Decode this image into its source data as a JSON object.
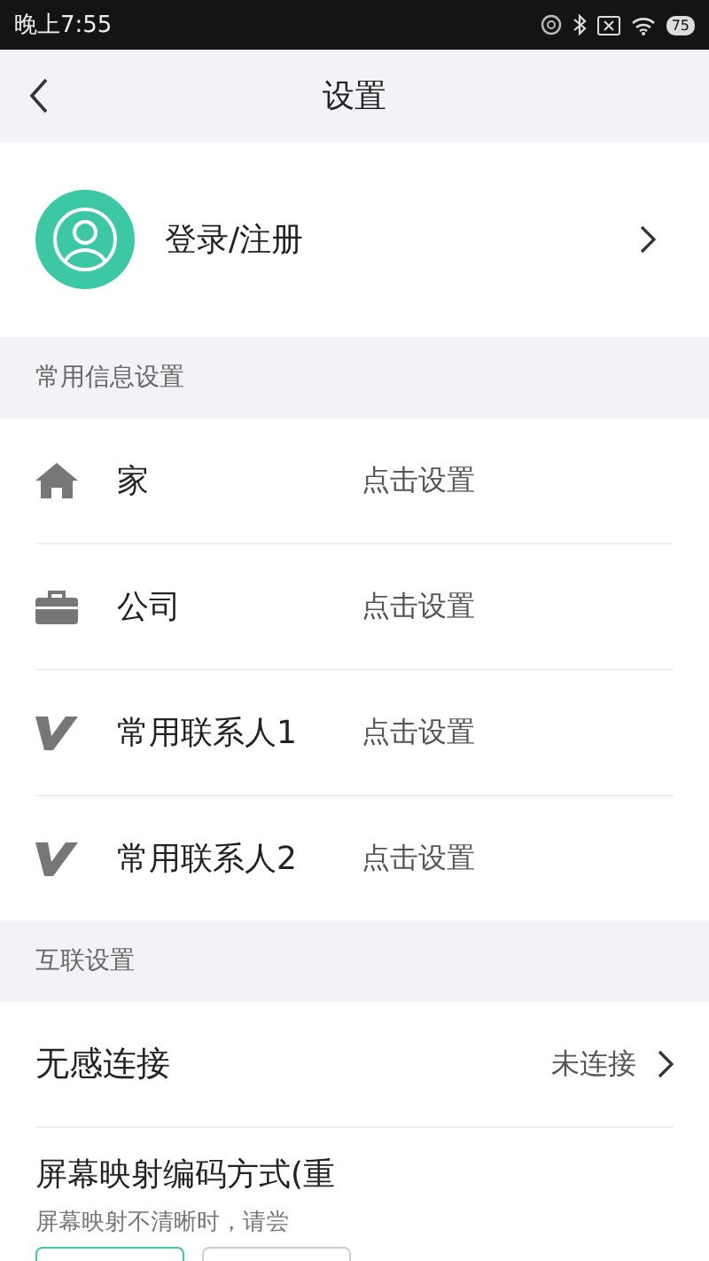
{
  "status_bar": {
    "time": "晚上7:55",
    "battery": "75"
  },
  "header": {
    "title": "设置"
  },
  "account": {
    "label": "登录/注册"
  },
  "sections": [
    {
      "title": "常用信息设置",
      "rows": [
        {
          "kind": "home",
          "label": "家",
          "value": "点击设置"
        },
        {
          "kind": "work",
          "label": "公司",
          "value": "点击设置"
        },
        {
          "kind": "contact",
          "label": "常用联系人1",
          "value": "点击设置"
        },
        {
          "kind": "contact",
          "label": "常用联系人2",
          "value": "点击设置"
        }
      ]
    },
    {
      "title": "互联设置",
      "rows": [
        {
          "kind": "link",
          "label": "无感连接",
          "value": "未连接"
        }
      ]
    }
  ],
  "encoding": {
    "title": "屏幕映射编码方式(重",
    "hint": "屏幕映射不清晰时，请尝",
    "options": [
      {
        "selected": true
      },
      {
        "selected": false
      }
    ]
  }
}
